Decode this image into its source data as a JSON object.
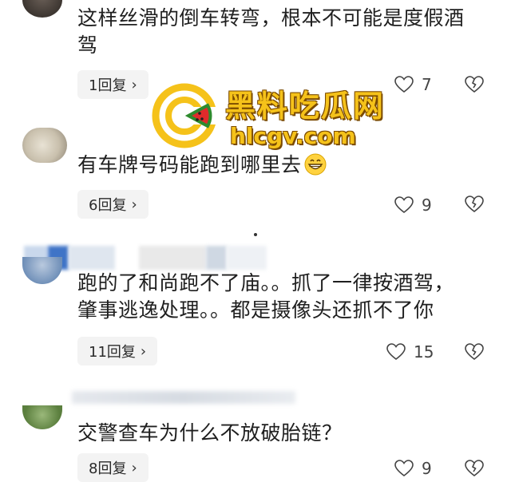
{
  "watermark": {
    "title": "黑料吃瓜网",
    "url": "hlcgv.com"
  },
  "comments": [
    {
      "text": "这样丝滑的倒车转弯，根本不可能是度假酒\n驾",
      "replies": "1回复",
      "likes": "7"
    },
    {
      "text": "有车牌号码能跑到哪里去",
      "emoji": "grinning-face-emoji",
      "replies": "6回复",
      "likes": "9"
    },
    {
      "text": "跑的了和尚跑不了庙。。抓了一律按酒驾，\n肇事逃逸处理。。都是摄像头还抓不了你",
      "replies": "11回复",
      "likes": "15"
    },
    {
      "text": "交警查车为什么不放破胎链？",
      "replies": "8回复",
      "likes": "9"
    }
  ],
  "colors": {
    "watermark_gold": "#f5c21a",
    "pill_bg": "#f3f3f3"
  }
}
